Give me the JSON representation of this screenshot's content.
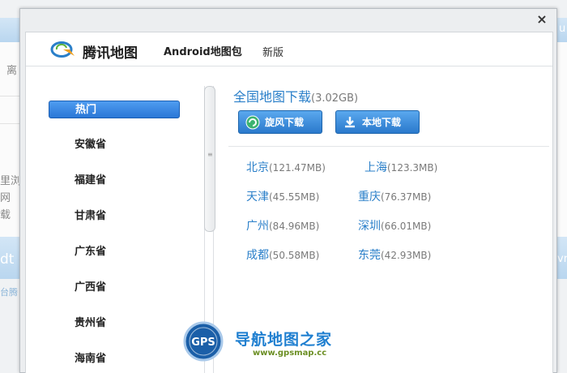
{
  "background": {
    "fragments_left": [
      "离",
      "里浏",
      "网",
      "载",
      "dt",
      "台腾"
    ],
    "fragments_right": [
      "u",
      "vr"
    ]
  },
  "dialog": {
    "close_glyph": "×",
    "header": {
      "logo_text": "腾讯地图",
      "package_title": "Android地图包",
      "new_tag": "新版"
    },
    "sidebar": {
      "provinces": [
        "热门",
        "安徽省",
        "福建省",
        "甘肃省",
        "广东省",
        "广西省",
        "贵州省",
        "海南省"
      ],
      "active_index": 0
    },
    "main": {
      "national_title": "全国地图下载",
      "national_size": "(3.02GB)",
      "buttons": {
        "whirlwind_label": "旋风下载",
        "local_label": "本地下载"
      },
      "cities": [
        {
          "name": "北京",
          "size": "(121.47MB)"
        },
        {
          "name": "上海",
          "size": "(123.3MB)"
        },
        {
          "name": "天津",
          "size": "(45.55MB)"
        },
        {
          "name": "重庆",
          "size": "(76.37MB)"
        },
        {
          "name": "广州",
          "size": "(84.96MB)"
        },
        {
          "name": "深圳",
          "size": "(66.01MB)"
        },
        {
          "name": "成都",
          "size": "(50.58MB)"
        },
        {
          "name": "东莞",
          "size": "(42.93MB)"
        }
      ]
    }
  },
  "watermark": {
    "badge": "GPS",
    "title": "导航地图之家",
    "url": "www.gpsmap.cc"
  },
  "colors": {
    "accent_blue": "#2a7fc9",
    "button_blue": "#2a79cc",
    "active_item": "#3a88e3"
  }
}
